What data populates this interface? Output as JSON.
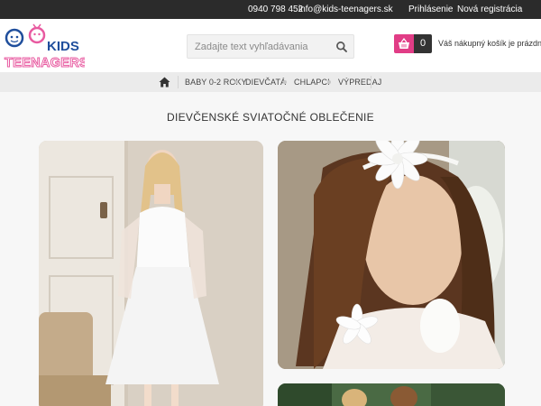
{
  "topbar": {
    "phone": "0940 798 452",
    "email": "info@kids-teenagers.sk",
    "login": "Prihlásenie",
    "register": "Nová registrácia"
  },
  "logo": {
    "kids": "KIDS",
    "teenagers": "TEENAGERS"
  },
  "search": {
    "placeholder": "Zadajte text vyhľadávania"
  },
  "cart": {
    "count": "0",
    "status": "Váš nákupný košík je prázdny"
  },
  "nav": {
    "items": [
      "BABY 0-2 ROKY",
      "DIEVČATÁ",
      "CHLAPCI",
      "VÝPREDAJ"
    ]
  },
  "main": {
    "title": "DIEVČENSKÉ SVIATOČNÉ OBLEČENIE"
  },
  "colors": {
    "topbar": "#2b2b2b",
    "accent": "#e13d86",
    "logo_blue": "#1f4e9c",
    "logo_pink": "#e85aa0"
  }
}
